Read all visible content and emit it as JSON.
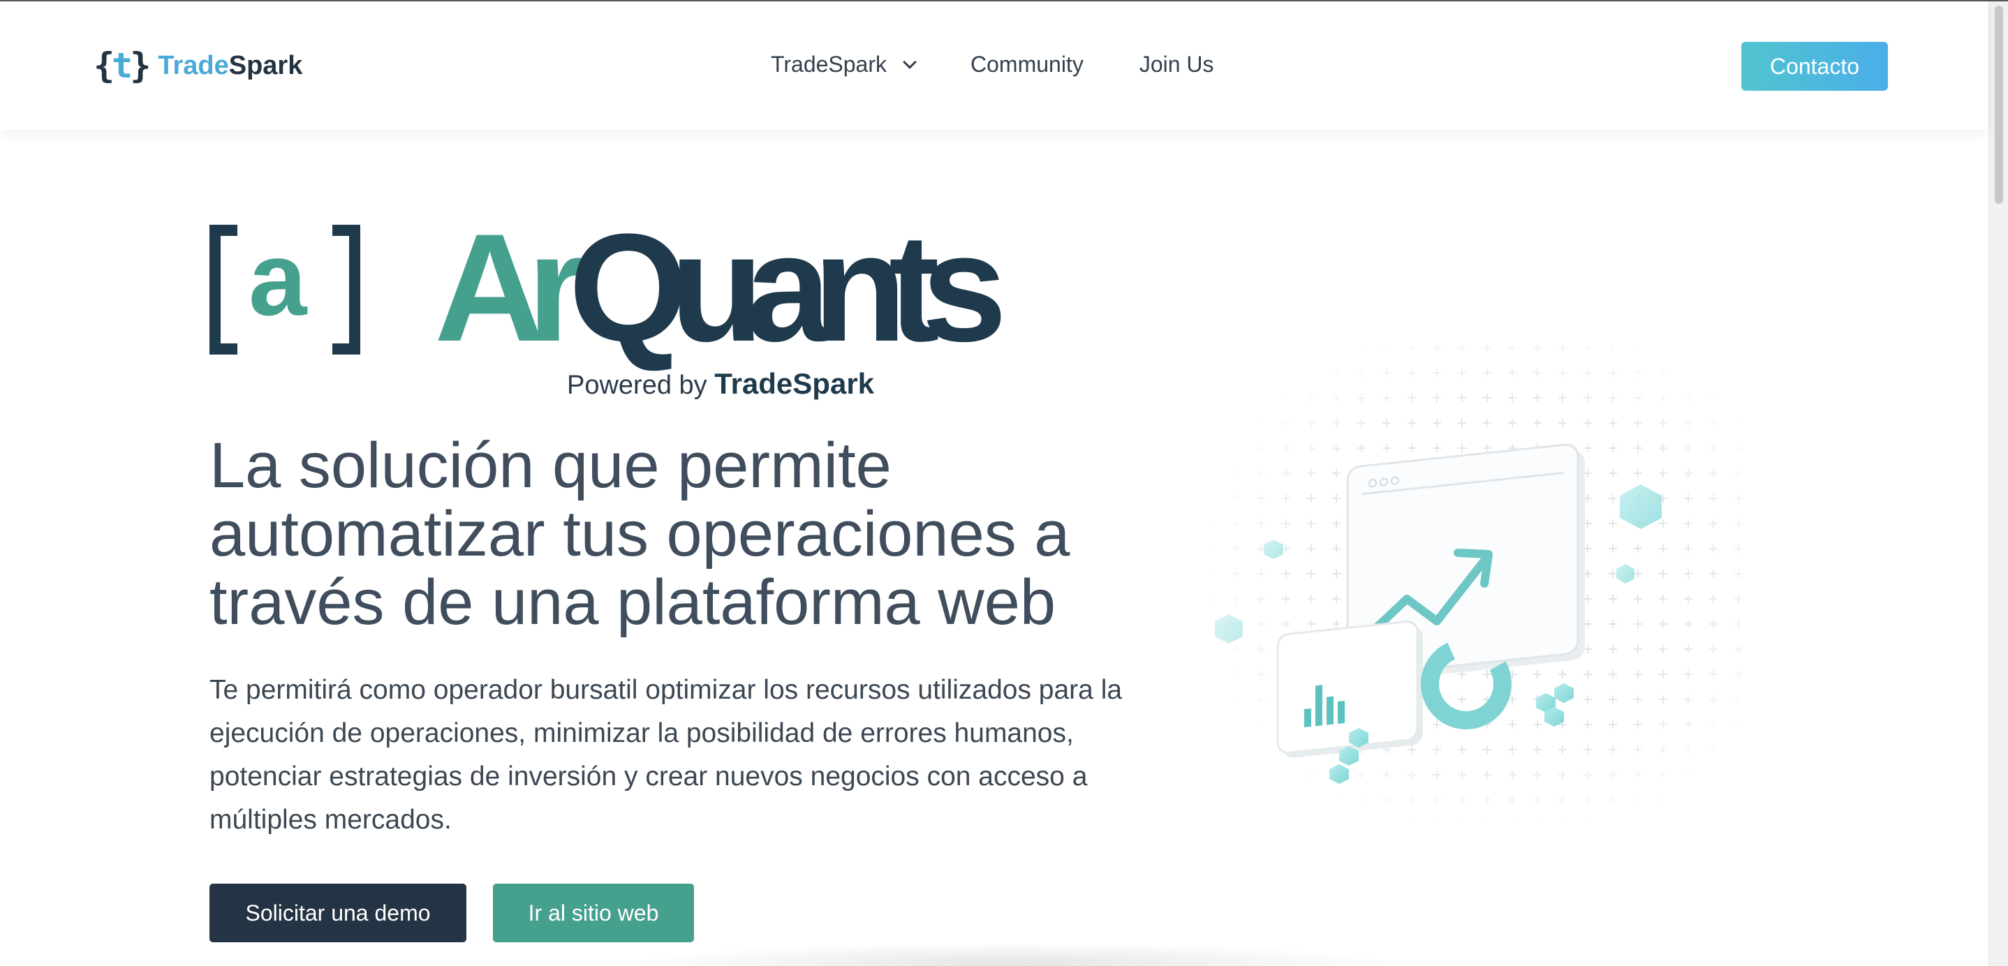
{
  "header": {
    "logo": {
      "mark": "{t}",
      "name_part1": "Trade",
      "name_part2": "Spark"
    },
    "nav": [
      {
        "label": "TradeSpark",
        "has_dropdown": true
      },
      {
        "label": "Community",
        "has_dropdown": false
      },
      {
        "label": "Join Us",
        "has_dropdown": false
      }
    ],
    "contact_label": "Contacto"
  },
  "hero": {
    "brand": {
      "bracket_letter": "a",
      "wordmark_part1": "Ar",
      "wordmark_part2": "Quants",
      "powered_prefix": "Powered by",
      "powered_brand": "TradeSpark"
    },
    "headline": "La solución que permite automatizar tus operaciones a través de una plataforma web",
    "description": "Te permitirá como operador bursatil optimizar los recursos utilizados para la ejecución de operaciones, minimizar la posibilidad de errores humanos, potenciar estrategias de inversión y crear nuevos negocios con acceso a múltiples mercados.",
    "primary_button": "Solicitar una demo",
    "secondary_button": "Ir al sitio web"
  },
  "colors": {
    "navy": "#253444",
    "teal": "#46a08e",
    "accent_blue": "#4aa9d6",
    "contact_gradient_start": "#52c4cf",
    "contact_gradient_end": "#4aaee9"
  },
  "icons": [
    "logo-icon",
    "chevron-down-icon",
    "trend-arrow-icon",
    "bar-chart-icon",
    "donut-chart-icon"
  ]
}
